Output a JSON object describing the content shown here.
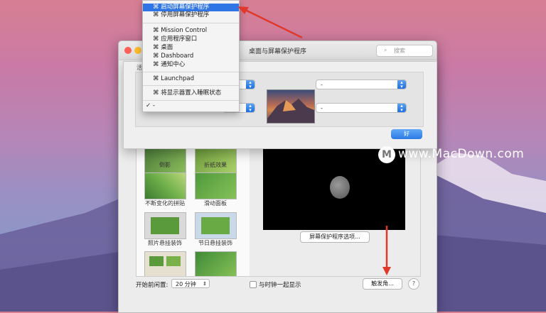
{
  "window": {
    "title": "桌面与屏幕保护程序",
    "search_placeholder": "搜索"
  },
  "left_panel_partial_label": "活",
  "screensavers": [
    {
      "label": "倒影"
    },
    {
      "label": "折纸效果"
    },
    {
      "label": "不断变化的拼贴"
    },
    {
      "label": "滑动面板"
    },
    {
      "label": "照片悬挂装饰"
    },
    {
      "label": "节日悬挂装饰"
    }
  ],
  "options_button": "屏幕保护程序选项...",
  "start_after_label": "开始前闲置:",
  "start_after_value": "20 分钟",
  "show_clock_label": "与时钟一起显示",
  "hot_corners_button": "触发角...",
  "help_label": "?",
  "hot_corners": {
    "top_left": "-",
    "top_right": "-",
    "bottom_left": "-",
    "bottom_right": "-",
    "ok_label": "好"
  },
  "menu": {
    "items": [
      {
        "label": "⌘ 启动屏幕保护程序",
        "active": true
      },
      {
        "label": "⌘ 停用屏幕保护程序"
      },
      {
        "label": "⌘ Mission Control"
      },
      {
        "label": "⌘ 应用程序窗口"
      },
      {
        "label": "⌘ 桌面"
      },
      {
        "label": "⌘ Dashboard"
      },
      {
        "label": "⌘ 通知中心"
      },
      {
        "label": "⌘ Launchpad"
      },
      {
        "label": "⌘ 将显示器置入睡眠状态"
      },
      {
        "label": "✓ -"
      }
    ]
  },
  "watermark": {
    "logo": "M",
    "text": "www.MacDown.com"
  },
  "colors": {
    "accent": "#2f75e6",
    "arrow": "#e0392b"
  }
}
